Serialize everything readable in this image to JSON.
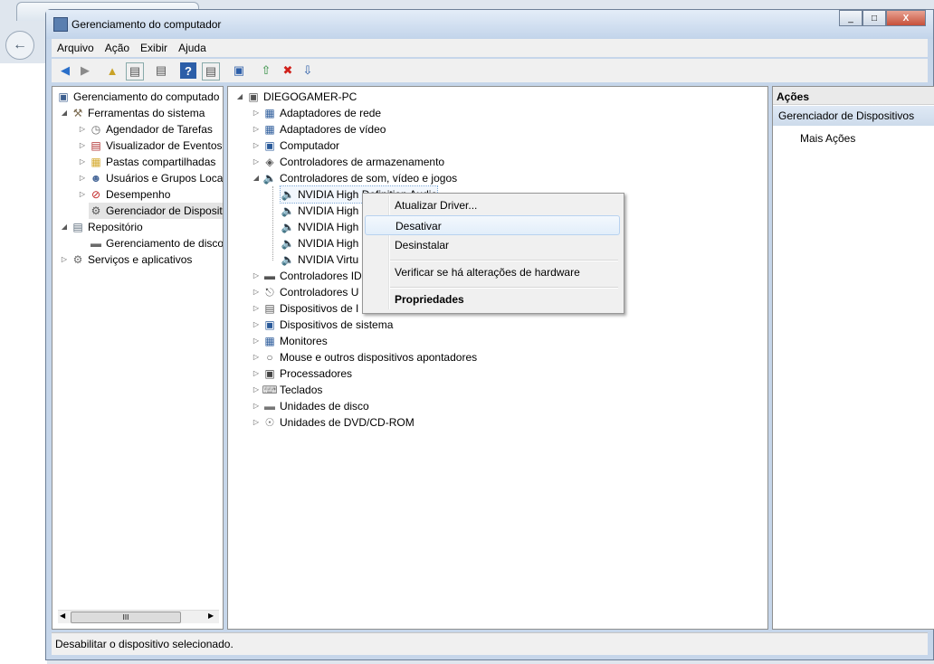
{
  "window": {
    "title": "Gerenciamento do computador",
    "min": "_",
    "max": "□",
    "close": "X"
  },
  "menu": [
    "Arquivo",
    "Ação",
    "Exibir",
    "Ajuda"
  ],
  "left_tree": {
    "root": "Gerenciamento do computado",
    "system_tools": "Ferramentas do sistema",
    "task_scheduler": "Agendador de Tarefas",
    "event_viewer": "Visualizador de Eventos",
    "shared_folders": "Pastas compartilhadas",
    "users_groups": "Usuários e Grupos Loca",
    "performance": "Desempenho",
    "device_manager": "Gerenciador de Disposit",
    "storage": "Repositório",
    "disk_management": "Gerenciamento de disco",
    "services": "Serviços e aplicativos"
  },
  "device_tree": {
    "computer": "DIEGOGAMER-PC",
    "categories": [
      "Adaptadores de rede",
      "Adaptadores de vídeo",
      "Computador",
      "Controladores de armazenamento",
      "Controladores de som, vídeo e jogos"
    ],
    "audio_devices": [
      "NVIDIA High Definition Audio",
      "NVIDIA High",
      "NVIDIA High",
      "NVIDIA High",
      "NVIDIA Virtu"
    ],
    "categories_after": [
      "Controladores ID",
      "Controladores U",
      "Dispositivos de I",
      "Dispositivos de sistema",
      "Monitores",
      "Mouse e outros dispositivos apontadores",
      "Processadores",
      "Teclados",
      "Unidades de disco",
      "Unidades de DVD/CD-ROM"
    ]
  },
  "context_menu": {
    "update_driver": "Atualizar Driver...",
    "disable": "Desativar",
    "uninstall": "Desinstalar",
    "scan": "Verificar se há alterações de hardware",
    "properties": "Propriedades"
  },
  "actions": {
    "header": "Ações",
    "section": "Gerenciador de Dispositivos",
    "more": "Mais Ações"
  },
  "status_text": "Desabilitar o dispositivo selecionado.",
  "scroll_grip": "III"
}
